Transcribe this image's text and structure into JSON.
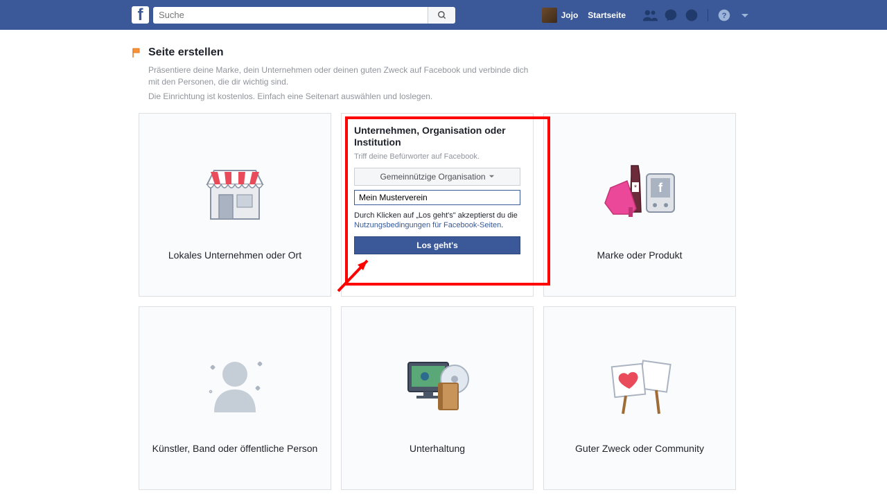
{
  "topbar": {
    "search_placeholder": "Suche",
    "user_name": "Jojo",
    "home_label": "Startseite"
  },
  "header": {
    "title": "Seite erstellen",
    "desc1": "Präsentiere deine Marke, dein Unternehmen oder deinen guten Zweck auf Facebook und verbinde dich mit den Personen, die dir wichtig sind.",
    "desc2": "Die Einrichtung ist kostenlos. Einfach eine Seitenart auswählen und loslegen."
  },
  "cards": {
    "local": "Lokales Unternehmen oder Ort",
    "brand": "Marke oder Produkt",
    "artist": "Künstler, Band oder öffentliche Person",
    "entertainment": "Unterhaltung",
    "cause": "Guter Zweck oder Community"
  },
  "expanded": {
    "title": "Unternehmen, Organisation oder Institution",
    "subtitle": "Triff deine Befürworter auf Facebook.",
    "category_selected": "Gemeinnützige Organisation",
    "name_value": "Mein Musterverein",
    "terms_prefix": "Durch Klicken auf „Los geht's\" akzeptierst du die ",
    "terms_link": "Nutzungsbedingungen für Facebook-Seiten",
    "terms_suffix": ".",
    "button": "Los geht's"
  }
}
